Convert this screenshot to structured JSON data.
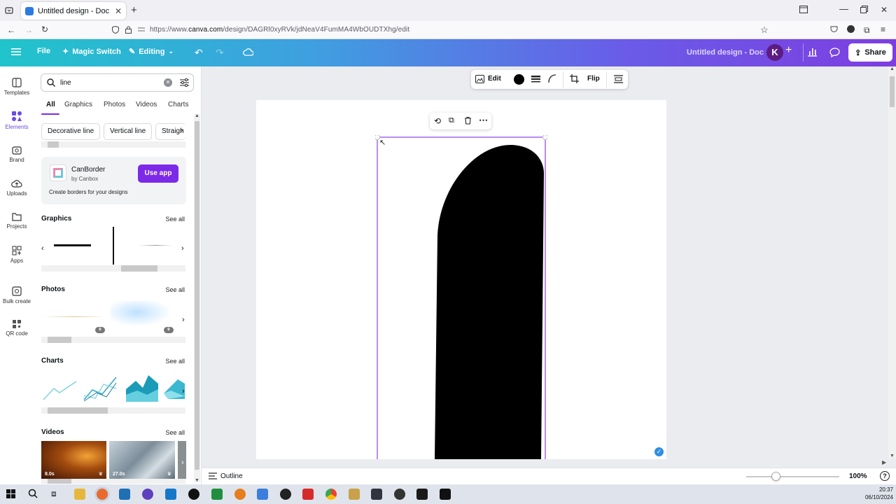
{
  "browser": {
    "tab_title": "Untitled design - Doc - Canva",
    "url_prefix": "https://www.",
    "url_domain": "canva.com",
    "url_path": "/design/DAGRl0xyRVk/jdNeaV4FumMA4WbOUDTXhg/edit"
  },
  "header": {
    "file_label": "File",
    "magic_label": "Magic Switch",
    "editing_label": "Editing",
    "doc_title": "Untitled design - Doc",
    "avatar_letter": "K",
    "share_label": "Share"
  },
  "rail": {
    "items": [
      "Templates",
      "Elements",
      "Brand",
      "Uploads",
      "Projects",
      "Apps",
      "Bulk create",
      "QR code"
    ]
  },
  "panel": {
    "search_value": "line",
    "tabs": [
      "All",
      "Graphics",
      "Photos",
      "Videos",
      "Charts"
    ],
    "suggestions": [
      "Decorative line",
      "Vertical line",
      "Straigh"
    ],
    "app_card": {
      "name": "CanBorder",
      "by": "by Canbox",
      "button": "Use app",
      "description": "Create borders for your designs"
    },
    "sections": {
      "graphics": "Graphics",
      "photos": "Photos",
      "charts": "Charts",
      "videos": "Videos",
      "see_all": "See all"
    },
    "video_durations": [
      "8.0s",
      "27.0s"
    ]
  },
  "toolbar": {
    "edit_label": "Edit",
    "flip_label": "Flip",
    "fill_color": "#000000"
  },
  "bottom": {
    "outline_label": "Outline",
    "zoom": "100%",
    "help": "?"
  },
  "taskbar": {
    "time": "20:37",
    "date": "06/10/2024"
  },
  "colors": {
    "accent": "#7d2ae8",
    "selection": "#8b3dff"
  }
}
